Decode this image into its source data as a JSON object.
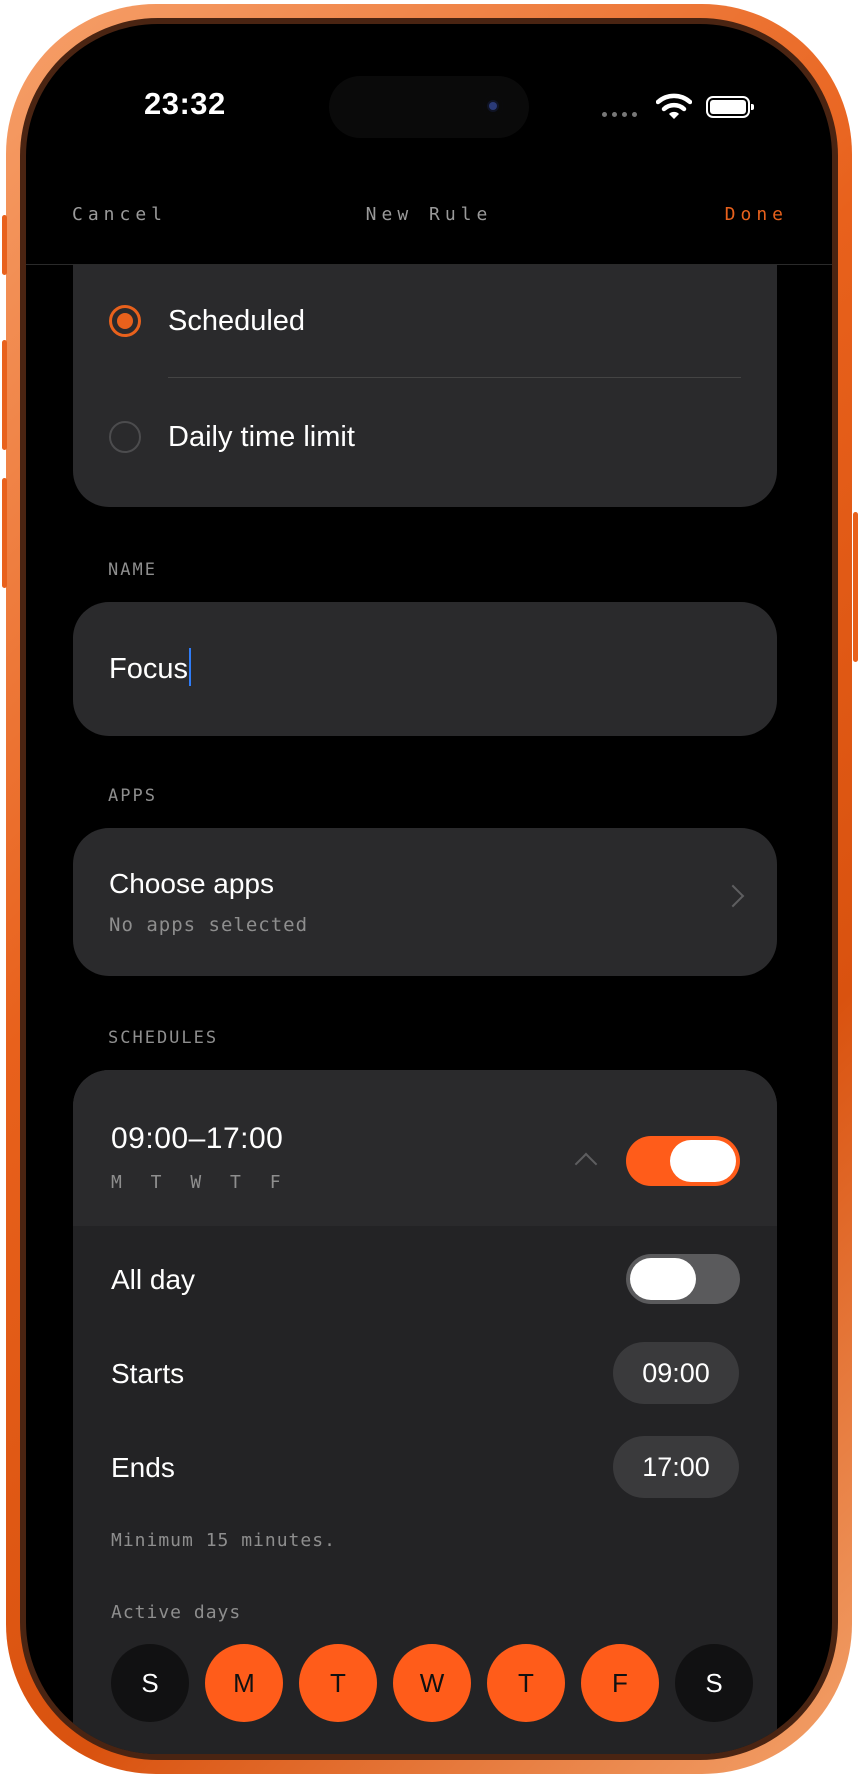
{
  "status_bar": {
    "time": "23:32"
  },
  "nav": {
    "cancel": "Cancel",
    "title": "New Rule",
    "done": "Done"
  },
  "rule_type": {
    "options": [
      {
        "label": "Scheduled",
        "selected": true
      },
      {
        "label": "Daily time limit",
        "selected": false
      }
    ]
  },
  "name_section": {
    "label": "NAME",
    "value": "Focus"
  },
  "apps_section": {
    "label": "APPS",
    "title": "Choose apps",
    "subtitle": "No apps selected"
  },
  "schedules_section": {
    "label": "SCHEDULES",
    "schedule": {
      "time_range": "09:00–17:00",
      "days_summary": "M T W T F",
      "enabled": true,
      "all_day": {
        "label": "All day",
        "enabled": false
      },
      "starts": {
        "label": "Starts",
        "value": "09:00"
      },
      "ends": {
        "label": "Ends",
        "value": "17:00"
      },
      "note": "Minimum 15 minutes.",
      "active_days_label": "Active days",
      "days": [
        {
          "letter": "S",
          "active": false
        },
        {
          "letter": "M",
          "active": true
        },
        {
          "letter": "T",
          "active": true
        },
        {
          "letter": "W",
          "active": true
        },
        {
          "letter": "T",
          "active": true
        },
        {
          "letter": "F",
          "active": true
        },
        {
          "letter": "S",
          "active": false
        }
      ]
    }
  },
  "colors": {
    "accent": "#ff5c1a",
    "card": "#2a2a2c",
    "background": "#000000"
  }
}
